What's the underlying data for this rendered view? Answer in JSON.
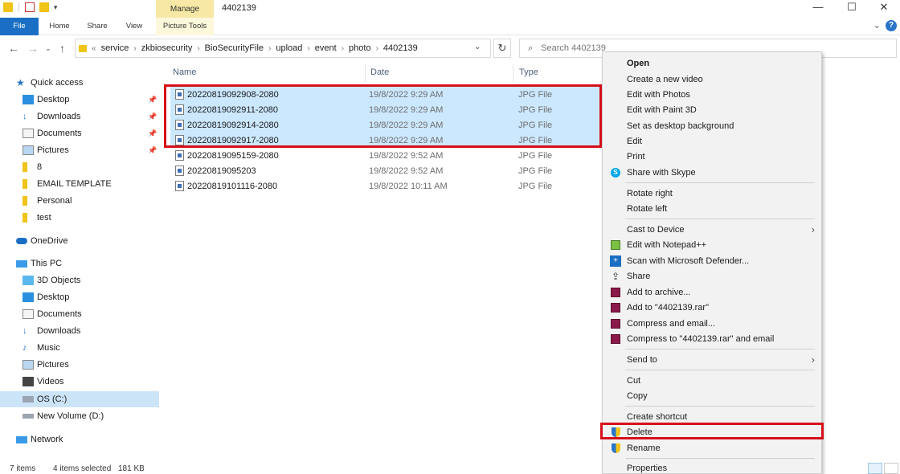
{
  "window": {
    "title": "4402139",
    "manage_tab": "Manage",
    "minimize": "—",
    "maximize": "☐",
    "close": "✕"
  },
  "ribbon": {
    "file": "File",
    "home": "Home",
    "share": "Share",
    "view": "View",
    "picture_tools": "Picture Tools"
  },
  "address": {
    "prefix": "«",
    "crumbs": [
      "service",
      "zkbiosecurity",
      "BioSecurityFile",
      "upload",
      "event",
      "photo",
      "4402139"
    ],
    "search_placeholder": "Search 4402139"
  },
  "nav": {
    "quick_access": "Quick access",
    "quick_items": [
      "Desktop",
      "Downloads",
      "Documents",
      "Pictures",
      "8",
      "EMAIL TEMPLATE",
      "Personal",
      "test"
    ],
    "onedrive": "OneDrive",
    "this_pc": "This PC",
    "pc_items": [
      "3D Objects",
      "Desktop",
      "Documents",
      "Downloads",
      "Music",
      "Pictures",
      "Videos",
      "OS (C:)",
      "New Volume (D:)"
    ],
    "network": "Network"
  },
  "columns": {
    "name": "Name",
    "date": "Date",
    "type": "Type"
  },
  "files": [
    {
      "name": "20220819092908-2080",
      "date": "19/8/2022 9:29 AM",
      "type": "JPG File",
      "selected": true
    },
    {
      "name": "20220819092911-2080",
      "date": "19/8/2022 9:29 AM",
      "type": "JPG File",
      "selected": true
    },
    {
      "name": "20220819092914-2080",
      "date": "19/8/2022 9:29 AM",
      "type": "JPG File",
      "selected": true
    },
    {
      "name": "20220819092917-2080",
      "date": "19/8/2022 9:29 AM",
      "type": "JPG File",
      "selected": true
    },
    {
      "name": "20220819095159-2080",
      "date": "19/8/2022 9:52 AM",
      "type": "JPG File",
      "selected": false
    },
    {
      "name": "20220819095203",
      "date": "19/8/2022 9:52 AM",
      "type": "JPG File",
      "selected": false
    },
    {
      "name": "20220819101116-2080",
      "date": "19/8/2022 10:11 AM",
      "type": "JPG File",
      "selected": false
    }
  ],
  "context_menu": {
    "open": "Open",
    "create_video": "Create a new video",
    "edit_photos": "Edit with Photos",
    "edit_paint3d": "Edit with Paint 3D",
    "set_background": "Set as desktop background",
    "edit": "Edit",
    "print": "Print",
    "share_skype": "Share with Skype",
    "rotate_right": "Rotate right",
    "rotate_left": "Rotate left",
    "cast": "Cast to Device",
    "notepad": "Edit with Notepad++",
    "defender": "Scan with Microsoft Defender...",
    "share": "Share",
    "add_archive": "Add to archive...",
    "add_rar": "Add to \"4402139.rar\"",
    "compress_email": "Compress and email...",
    "compress_rar_email": "Compress to \"4402139.rar\" and email",
    "send_to": "Send to",
    "cut": "Cut",
    "copy": "Copy",
    "create_shortcut": "Create shortcut",
    "delete": "Delete",
    "rename": "Rename",
    "properties": "Properties"
  },
  "status": {
    "items": "7 items",
    "selected": "4 items selected",
    "size": "181 KB"
  },
  "colors": {
    "accent": "#1a6fc4",
    "selection": "#cce8ff",
    "highlight_box": "#d60f1a",
    "manage_tab": "#f7e9a5"
  }
}
